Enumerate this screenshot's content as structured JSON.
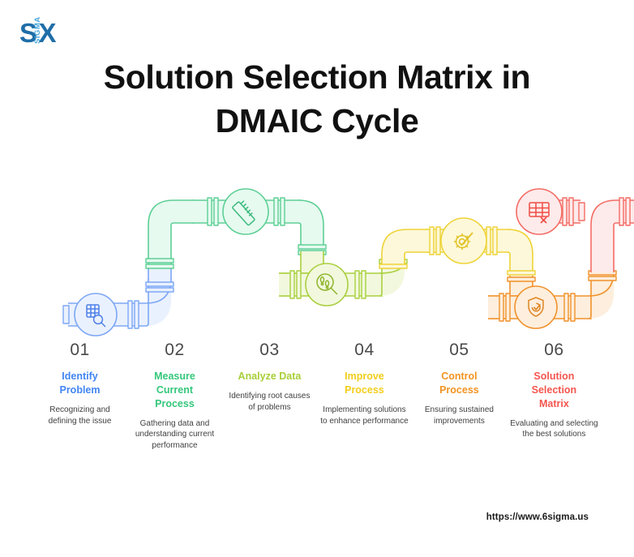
{
  "brand": {
    "logo_s": "S",
    "logo_sigma": "SIGMA",
    "logo_x": "X",
    "logo_color_dark": "#1f6ea8",
    "logo_color_light": "#4aa8dc"
  },
  "header": {
    "title_line1": "Solution Selection Matrix in",
    "title_line2": "DMAIC Cycle"
  },
  "footer": {
    "url": "https://www.6sigma.us"
  },
  "diagram": {
    "type": "pipeline-process-flow",
    "segments": 6
  },
  "steps": [
    {
      "number": "01",
      "title": "Identify\nProblem",
      "title_line1": "Identify",
      "title_line2": "Problem",
      "description": "Recognizing and defining the issue",
      "color": "#4285F4",
      "icon": "puzzle-magnifier-icon",
      "vertical_position": "low"
    },
    {
      "number": "02",
      "title": "Measure\nCurrent\nProcess",
      "title_line1": "Measure",
      "title_line2": "Current",
      "title_line3": "Process",
      "description": "Gathering data and understanding current performance",
      "color": "#34C77B",
      "icon": "ruler-icon",
      "vertical_position": "high"
    },
    {
      "number": "03",
      "title": "Analyze Data",
      "title_line1": "Analyze Data",
      "description": "Identifying root causes of problems",
      "color": "#A8CF38",
      "icon": "magnifier-footprints-icon",
      "vertical_position": "mid"
    },
    {
      "number": "04",
      "title": "Improve\nProcess",
      "title_line1": "Improve",
      "title_line2": "Process",
      "description": "Implementing solutions to enhance performance",
      "color": "#F2CE1B",
      "icon": "gear-check-icon",
      "vertical_position": "upper-mid"
    },
    {
      "number": "05",
      "title": "Control\nProcess",
      "title_line1": "Control",
      "title_line2": "Process",
      "description": "Ensuring sustained improvements",
      "color": "#F29422",
      "icon": "shield-check-icon",
      "vertical_position": "low"
    },
    {
      "number": "06",
      "title": "Solution\nSelection\nMatrix",
      "title_line1": "Solution",
      "title_line2": "Selection",
      "title_line3": "Matrix",
      "description": "Evaluating and selecting the best solutions",
      "color": "#F4564E",
      "icon": "matrix-table-icon",
      "vertical_position": "high"
    }
  ]
}
